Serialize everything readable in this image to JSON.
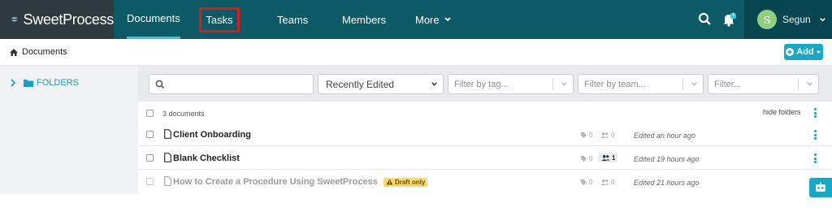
{
  "brand": {
    "name": "SweetProcess"
  },
  "nav": {
    "items": [
      {
        "label": "Documents",
        "active": true
      },
      {
        "label": "Tasks",
        "highlighted": true
      },
      {
        "label": "Teams"
      },
      {
        "label": "Members"
      },
      {
        "label": "More"
      }
    ]
  },
  "user": {
    "initial": "S",
    "name": "Segun"
  },
  "notifications": {
    "count": "1"
  },
  "breadcrumb": {
    "label": "Documents"
  },
  "add_button": {
    "label": "Add"
  },
  "sidebar": {
    "folders_label": "FOLDERS"
  },
  "filters": {
    "search_value": "",
    "sort_selected": "Recently Edited",
    "tag_placeholder": "Filter by tag...",
    "team_placeholder": "Filter by team...",
    "filter_placeholder": "Filter..."
  },
  "list": {
    "count_label": "3 documents",
    "hide_folders_label": "hide folders",
    "rows": [
      {
        "title": "Client Onboarding",
        "tags": "0",
        "teams": "0",
        "edited": "Edited an hour ago",
        "draft": false
      },
      {
        "title": "Blank Checklist",
        "tags": "0",
        "teams": "1",
        "edited": "Edited 19 hours ago",
        "draft": false
      },
      {
        "title": "How to Create a Procedure Using SweetProcess",
        "draft_label": "Draft only",
        "tags": "0",
        "teams": "0",
        "edited": "Edited 21 hours ago",
        "draft": true
      }
    ]
  },
  "colors": {
    "topbar": "#0b5a66",
    "logo_bg": "#2f3a40",
    "accent": "#17a8c8",
    "highlight_box": "#e01818",
    "draft_badge": "#fcd86a"
  }
}
